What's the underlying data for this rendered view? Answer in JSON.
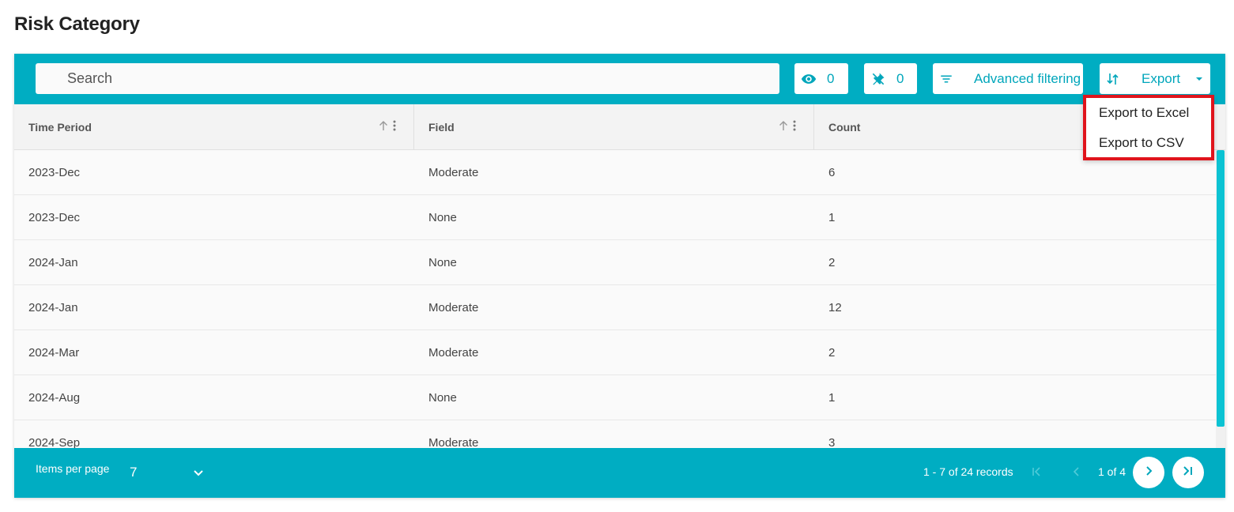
{
  "page": {
    "title": "Risk Category"
  },
  "toolbar": {
    "search_placeholder": "Search",
    "hidden_count": "0",
    "pinned_count": "0",
    "advanced_filter_label": "Advanced filtering",
    "export_label": "Export"
  },
  "export_menu": {
    "items": [
      "Export to Excel",
      "Export to CSV"
    ]
  },
  "table": {
    "columns": [
      "Time Period",
      "Field",
      "Count"
    ],
    "rows": [
      [
        "2023-Dec",
        "Moderate",
        "6"
      ],
      [
        "2023-Dec",
        "None",
        "1"
      ],
      [
        "2024-Jan",
        "None",
        "2"
      ],
      [
        "2024-Jan",
        "Moderate",
        "12"
      ],
      [
        "2024-Mar",
        "Moderate",
        "2"
      ],
      [
        "2024-Aug",
        "None",
        "1"
      ],
      [
        "2024-Sep",
        "Moderate",
        "3"
      ]
    ]
  },
  "pager": {
    "items_per_page_label": "Items per page",
    "items_per_page_value": "7",
    "records_text": "1 - 7 of 24 records",
    "page_text": "1 of 4"
  },
  "colors": {
    "accent": "#00adc2",
    "highlight_border": "#e0141c"
  }
}
